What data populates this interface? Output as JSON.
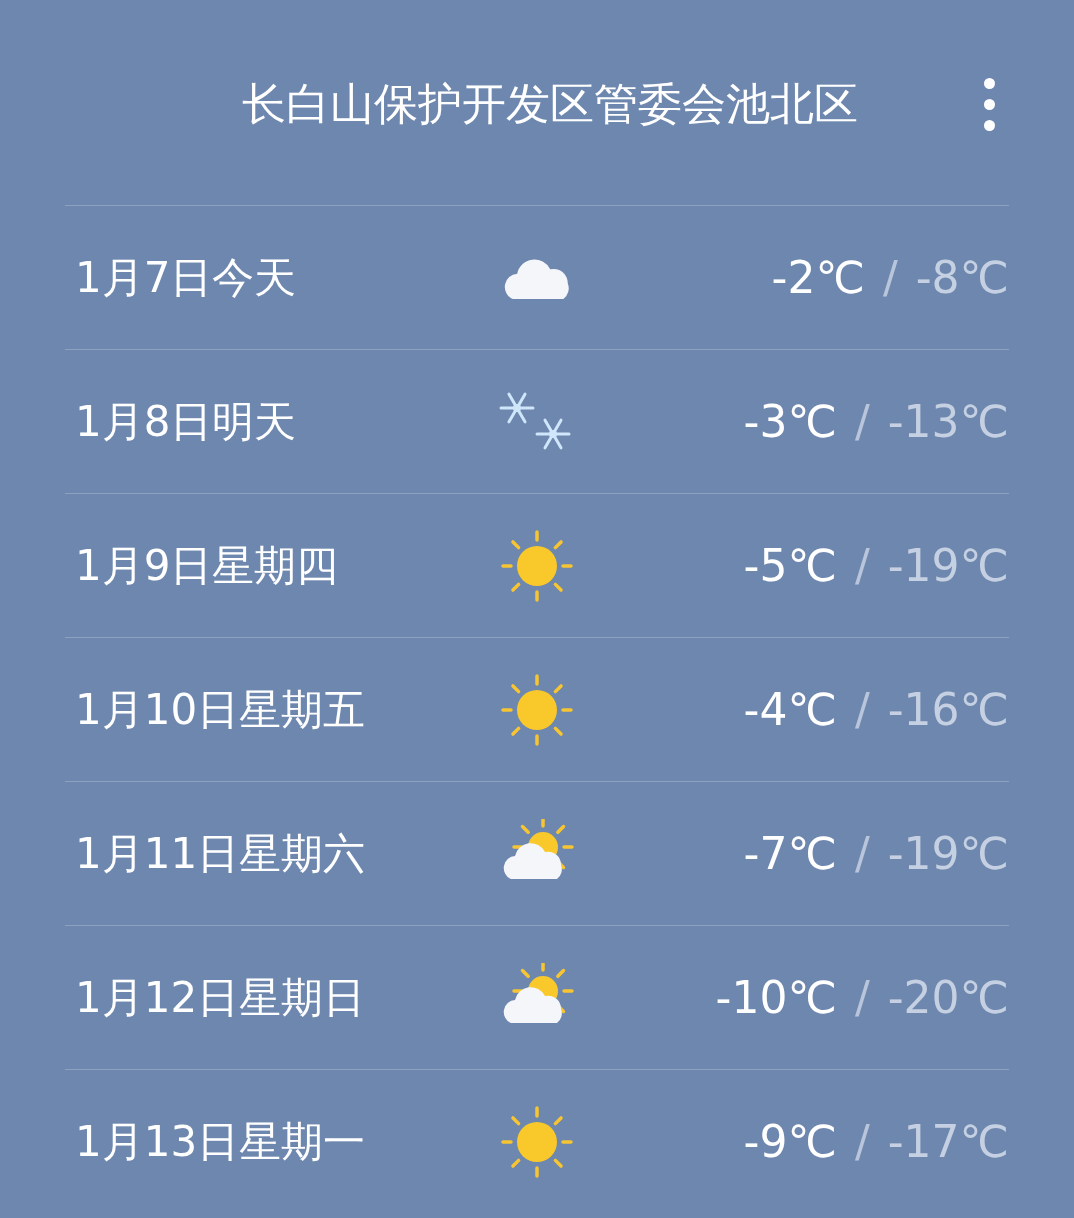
{
  "header": {
    "title": "长白山保护开发区管委会池北区"
  },
  "days": [
    {
      "date": "1月7日今天",
      "kind": "cloudy",
      "high": "-2℃",
      "separator": "/",
      "low": "-8℃"
    },
    {
      "date": "1月8日明天",
      "kind": "snow",
      "high": "-3℃",
      "separator": "/",
      "low": "-13℃"
    },
    {
      "date": "1月9日星期四",
      "kind": "sunny",
      "high": "-5℃",
      "separator": "/",
      "low": "-19℃"
    },
    {
      "date": "1月10日星期五",
      "kind": "sunny",
      "high": "-4℃",
      "separator": "/",
      "low": "-16℃"
    },
    {
      "date": "1月11日星期六",
      "kind": "partly_cloudy",
      "high": "-7℃",
      "separator": "/",
      "low": "-19℃"
    },
    {
      "date": "1月12日星期日",
      "kind": "partly_cloudy",
      "high": "-10℃",
      "separator": "/",
      "low": "-20℃"
    },
    {
      "date": "1月13日星期一",
      "kind": "sunny",
      "high": "-9℃",
      "separator": "/",
      "low": "-17℃"
    }
  ]
}
